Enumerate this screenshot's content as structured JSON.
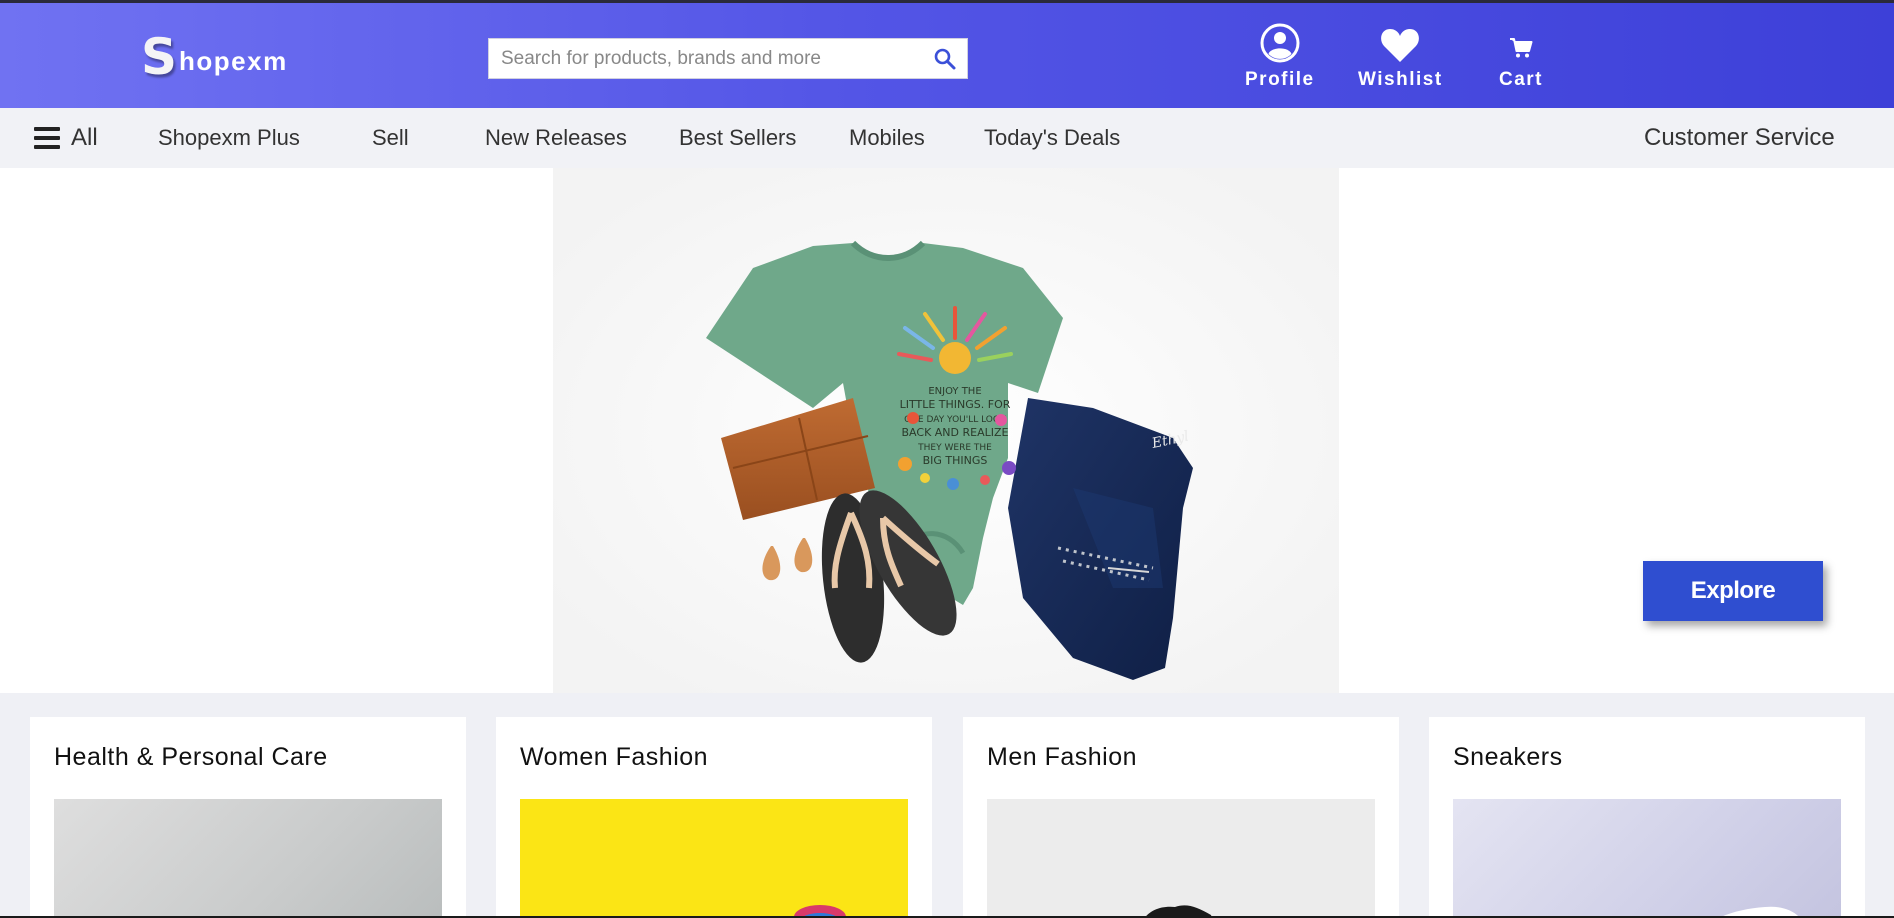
{
  "brand": {
    "logo_letter": "S",
    "logo_rest": "hopexm"
  },
  "search": {
    "placeholder": "Search for products, brands and more"
  },
  "header_actions": {
    "profile": "Profile",
    "wishlist": "Wishlist",
    "cart": "Cart"
  },
  "nav": {
    "all": "All",
    "items": [
      "Shopexm Plus",
      "Sell",
      "New Releases",
      "Best Sellers",
      "Mobiles",
      "Today's Deals"
    ],
    "customer_service": "Customer Service"
  },
  "hero": {
    "explore_label": "Explore",
    "shirt_print": [
      "ENJOY THE",
      "LITTLE THINGS. FOR",
      "ONE DAY YOU'LL LOOK",
      "BACK AND REALIZE",
      "THEY WERE THE",
      "BIG THINGS"
    ],
    "jeans_tag": "Ethyl"
  },
  "categories": [
    "Health & Personal Care",
    "Women Fashion",
    "Men Fashion",
    "Sneakers"
  ],
  "colors": {
    "header_start": "#7072f2",
    "header_end": "#3d40d8",
    "accent": "#2f4ed0",
    "nav_bg": "#f1f2f6"
  }
}
